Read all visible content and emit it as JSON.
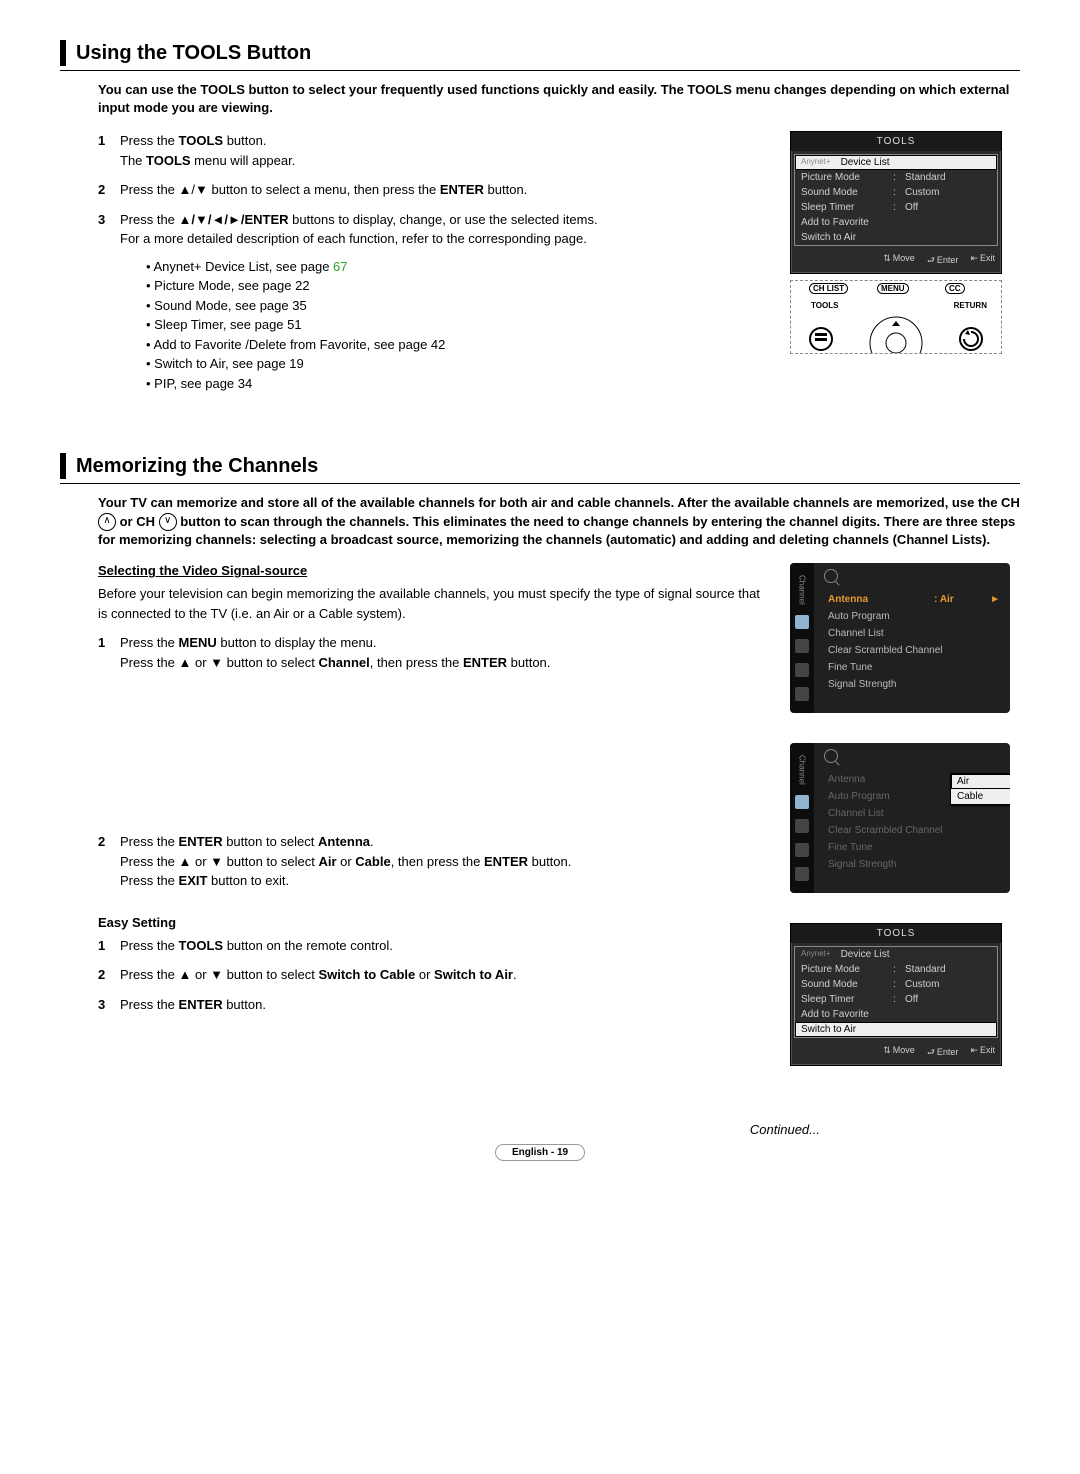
{
  "section1": {
    "title": "Using the TOOLS Button",
    "intro": "You can use the TOOLS button to select your frequently used functions quickly and easily. The TOOLS menu changes depending on which external input mode you are viewing.",
    "steps": {
      "s1a": "Press the ",
      "s1b": "TOOLS",
      "s1c": " button.",
      "s1d": "The ",
      "s1e": "TOOLS",
      "s1f": " menu will appear.",
      "s2a": "Press the ▲/▼ button to select a menu, then press the ",
      "s2b": "ENTER",
      "s2c": " button.",
      "s3a": "Press the ",
      "s3b": "▲/▼/◄/►/ENTER",
      "s3c": " buttons to display, change, or use the selected items.",
      "s3d": "For a more detailed description of each function, refer to the corresponding page."
    },
    "bullets": {
      "b1a": "Anynet+ Device List, see page ",
      "b1b": "67",
      "b2": "Picture Mode, see page 22",
      "b3": "Sound Mode, see page 35",
      "b4": "Sleep Timer, see page 51",
      "b5": "Add to Favorite /Delete from Favorite, see page 42",
      "b6": "Switch to Air, see page 19",
      "b7": "PIP, see page 34"
    }
  },
  "tools_osd": {
    "title": "TOOLS",
    "rows": [
      {
        "label": "Device List",
        "value": "",
        "hl": true,
        "prefix": "Anynet+"
      },
      {
        "label": "Picture Mode",
        "value": "Standard"
      },
      {
        "label": "Sound Mode",
        "value": "Custom"
      },
      {
        "label": "Sleep Timer",
        "value": "Off"
      },
      {
        "label": "Add to Favorite",
        "value": ""
      },
      {
        "label": "Switch to Air",
        "value": ""
      }
    ],
    "footer": {
      "move": "Move",
      "enter": "Enter",
      "exit": "Exit"
    }
  },
  "remote": {
    "chlist": "CH LIST",
    "menu": "MENU",
    "cc": "CC",
    "tools": "TOOLS",
    "return": "RETURN"
  },
  "section2": {
    "title": "Memorizing the Channels",
    "intro_a": "Your TV can memorize and store all of the available channels for both air and cable channels. After the available channels are memorized, use the CH ",
    "intro_b": " or CH ",
    "intro_c": " button to scan through the channels. This eliminates the need to change channels by entering the channel digits. There are three steps for memorizing channels: selecting a broadcast source, memorizing the channels (automatic) and adding and deleting channels (Channel Lists).",
    "subhead": "Selecting the Video Signal-source",
    "lead": "Before your television can begin memorizing the available channels, you must specify the type of signal source that is connected to the TV (i.e. an Air or a Cable system).",
    "steps1": {
      "s1a": "Press the ",
      "s1b": "MENU",
      "s1c": " button to display the menu.",
      "s1d": "Press the ▲ or ▼ button to select ",
      "s1e": "Channel",
      "s1f": ", then press the ",
      "s1g": "ENTER",
      "s1h": " button."
    },
    "steps2": {
      "s2a": "Press the ",
      "s2b": "ENTER",
      "s2c": " button to select ",
      "s2d": "Antenna",
      "s2e": ".",
      "s2f": "Press the ▲ or ▼ button to select ",
      "s2g": "Air",
      "s2h": " or ",
      "s2i": "Cable",
      "s2j": ", then press the ",
      "s2k": "ENTER",
      "s2l": " button.",
      "s2m": "Press the ",
      "s2n": "EXIT",
      "s2o": " button to exit."
    },
    "easy_head": "Easy Setting",
    "easy": {
      "e1a": "Press the ",
      "e1b": "TOOLS",
      "e1c": " button on the remote control.",
      "e2a": "Press the ▲ or ▼ button to select ",
      "e2b": "Switch to Cable",
      "e2c": " or ",
      "e2d": "Switch to Air",
      "e2e": ".",
      "e3a": "Press the ",
      "e3b": "ENTER",
      "e3c": " button."
    }
  },
  "chmenu1": {
    "tab": "Channel",
    "rows": [
      {
        "label": "Antenna",
        "value": ": Air",
        "sel": true,
        "arrow": true
      },
      {
        "label": "Auto Program"
      },
      {
        "label": "Channel List"
      },
      {
        "label": "Clear Scrambled Channel"
      },
      {
        "label": "Fine Tune"
      },
      {
        "label": "Signal Strength"
      }
    ]
  },
  "chmenu2": {
    "tab": "Channel",
    "rows": [
      {
        "label": "Antenna",
        "dim": true
      },
      {
        "label": "Auto Program",
        "dim": true
      },
      {
        "label": "Channel List",
        "dim": true
      },
      {
        "label": "Clear Scrambled Channel",
        "dim": true
      },
      {
        "label": "Fine Tune",
        "dim": true
      },
      {
        "label": "Signal Strength",
        "dim": true
      }
    ],
    "popup": [
      "Air",
      "Cable"
    ],
    "popup_sel": 0
  },
  "tools_osd2": {
    "title": "TOOLS",
    "rows": [
      {
        "label": "Device List",
        "value": "",
        "prefix": "Anynet+"
      },
      {
        "label": "Picture Mode",
        "value": "Standard"
      },
      {
        "label": "Sound Mode",
        "value": "Custom"
      },
      {
        "label": "Sleep Timer",
        "value": "Off"
      },
      {
        "label": "Add to Favorite",
        "value": ""
      },
      {
        "label": "Switch to Air",
        "value": "",
        "hl": true
      }
    ],
    "footer": {
      "move": "Move",
      "enter": "Enter",
      "exit": "Exit"
    }
  },
  "continued": "Continued...",
  "footer": "English - 19"
}
